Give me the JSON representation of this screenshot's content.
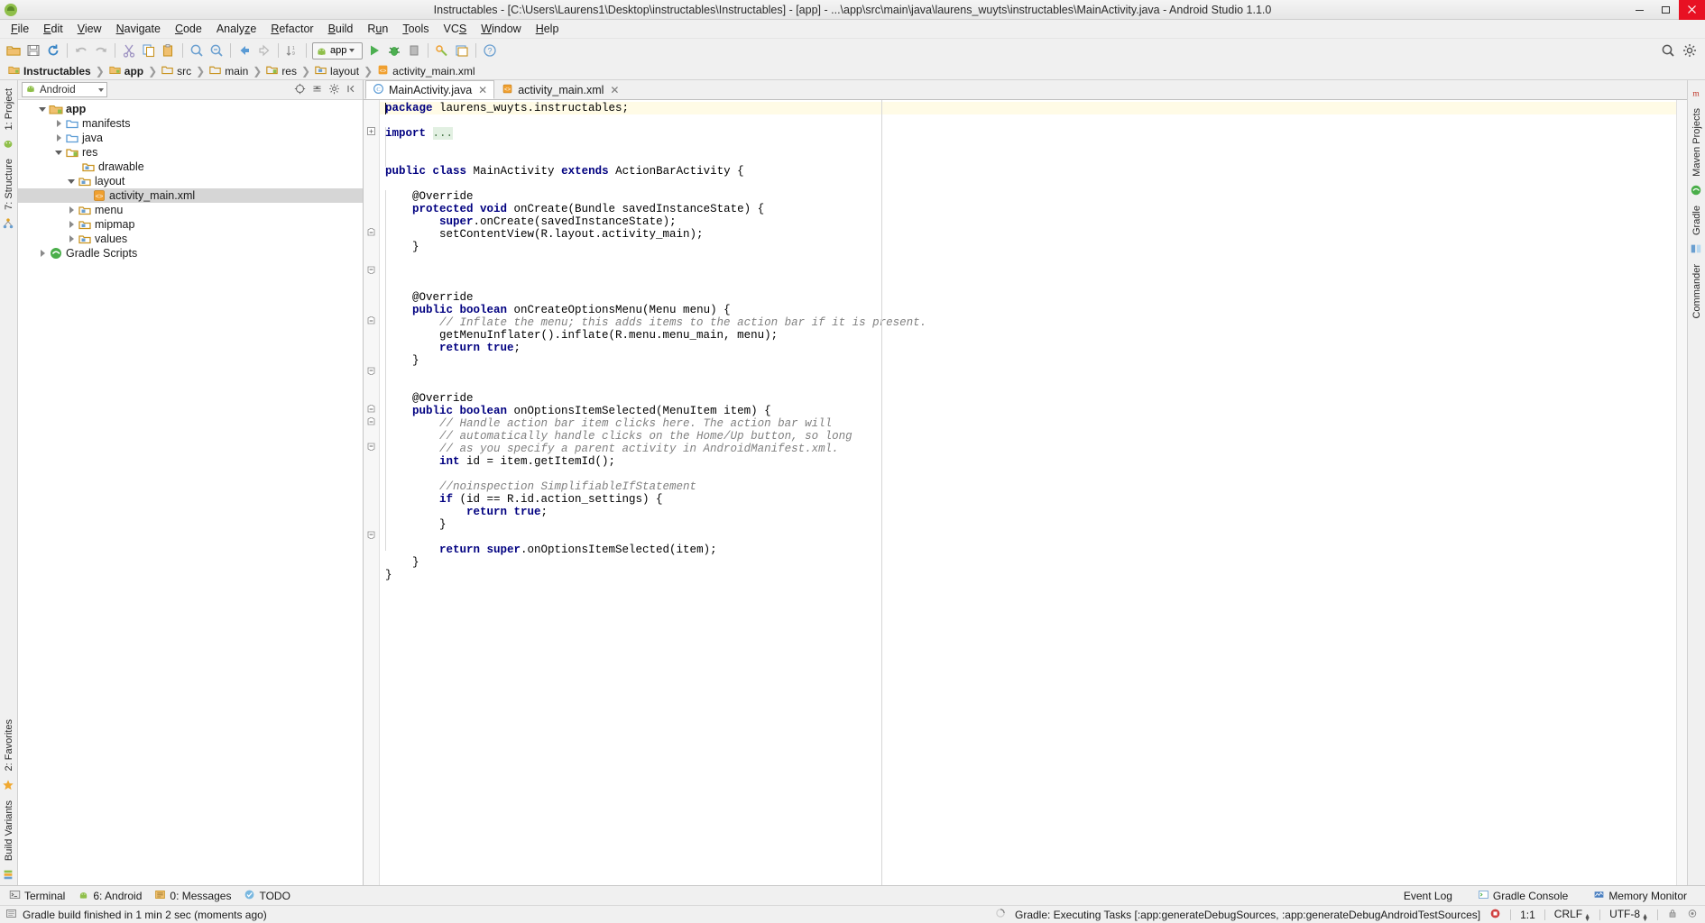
{
  "window": {
    "title": "Instructables - [C:\\Users\\Laurens1\\Desktop\\instructables\\Instructables] - [app] - ...\\app\\src\\main\\java\\laurens_wuyts\\instructables\\MainActivity.java - Android Studio 1.1.0",
    "minimize_label": "—",
    "maximize_label": "▢",
    "close_label": "✕"
  },
  "menubar": {
    "items": [
      {
        "label": "File"
      },
      {
        "label": "Edit"
      },
      {
        "label": "View"
      },
      {
        "label": "Navigate"
      },
      {
        "label": "Code"
      },
      {
        "label": "Analyze"
      },
      {
        "label": "Refactor"
      },
      {
        "label": "Build"
      },
      {
        "label": "Run"
      },
      {
        "label": "Tools"
      },
      {
        "label": "VCS"
      },
      {
        "label": "Window"
      },
      {
        "label": "Help"
      }
    ]
  },
  "toolbar": {
    "run_config": "app",
    "icons": [
      "open-folder-icon",
      "save-all-icon",
      "sync-icon",
      "undo-icon",
      "redo-icon",
      "cut-icon",
      "copy-icon",
      "paste-icon",
      "find-icon",
      "replace-icon",
      "back-icon",
      "forward-icon",
      "sort-icon"
    ],
    "right_icons": [
      "search-everywhere-icon",
      "settings-icon"
    ]
  },
  "breadcrumbs": {
    "items": [
      {
        "label": "Instructables",
        "icon": "module-icon",
        "bold": true
      },
      {
        "label": "app",
        "icon": "module-icon",
        "bold": true
      },
      {
        "label": "src",
        "icon": "folder-icon",
        "bold": false
      },
      {
        "label": "main",
        "icon": "folder-icon",
        "bold": false
      },
      {
        "label": "res",
        "icon": "res-folder-icon",
        "bold": false
      },
      {
        "label": "layout",
        "icon": "res-folder-icon",
        "bold": false
      },
      {
        "label": "activity_main.xml",
        "icon": "xml-file-icon",
        "bold": false
      }
    ],
    "separator": "❯"
  },
  "left_rail": {
    "items": [
      {
        "label": "1: Project",
        "icon": "project-icon"
      },
      {
        "label": "7: Structure",
        "icon": "structure-icon"
      },
      {
        "label": "2: Favorites",
        "icon": "favorites-star-icon"
      },
      {
        "label": "Build Variants",
        "icon": "build-variants-icon"
      }
    ]
  },
  "right_rail": {
    "items": [
      {
        "label": "Maven Projects",
        "icon": "maven-icon"
      },
      {
        "label": "Gradle",
        "icon": "gradle-icon"
      },
      {
        "label": "Commander",
        "icon": "commander-icon"
      }
    ]
  },
  "project_panel": {
    "view_selector": "Android",
    "view_icon": "android-icon",
    "header_icons": [
      "target-icon",
      "collapse-all-icon",
      "settings-gear-icon",
      "hide-icon"
    ],
    "tree": [
      {
        "label": "app",
        "depth": 0,
        "twisty": "down",
        "icon": "module-icon",
        "bold": true,
        "selected": false
      },
      {
        "label": "manifests",
        "depth": 1,
        "twisty": "right",
        "icon": "folder-blue-icon",
        "bold": false,
        "selected": false
      },
      {
        "label": "java",
        "depth": 1,
        "twisty": "right",
        "icon": "folder-blue-icon",
        "bold": false,
        "selected": false
      },
      {
        "label": "res",
        "depth": 1,
        "twisty": "down",
        "icon": "res-folder-icon",
        "bold": false,
        "selected": false
      },
      {
        "label": "drawable",
        "depth": 2,
        "twisty": "none",
        "icon": "res-folder-icon",
        "bold": false,
        "selected": false
      },
      {
        "label": "layout",
        "depth": 2,
        "twisty": "down",
        "icon": "res-folder-icon",
        "bold": false,
        "selected": false
      },
      {
        "label": "activity_main.xml",
        "depth": 3,
        "twisty": "none",
        "icon": "xml-file-icon",
        "bold": false,
        "selected": true
      },
      {
        "label": "menu",
        "depth": 2,
        "twisty": "right",
        "icon": "res-folder-icon",
        "bold": false,
        "selected": false
      },
      {
        "label": "mipmap",
        "depth": 2,
        "twisty": "right",
        "icon": "res-folder-icon",
        "bold": false,
        "selected": false
      },
      {
        "label": "values",
        "depth": 2,
        "twisty": "right",
        "icon": "res-folder-icon",
        "bold": false,
        "selected": false
      },
      {
        "label": "Gradle Scripts",
        "depth": 0,
        "twisty": "right",
        "icon": "gradle-icon",
        "bold": false,
        "selected": false
      }
    ]
  },
  "editor": {
    "tabs": [
      {
        "label": "MainActivity.java",
        "icon": "java-class-icon",
        "active": true,
        "close": "✕"
      },
      {
        "label": "activity_main.xml",
        "icon": "xml-file-icon",
        "active": false,
        "close": "✕"
      }
    ],
    "code_lines": [
      [
        {
          "t": "package ",
          "c": "kw"
        },
        {
          "t": "laurens_wuyts.instructables;",
          "c": "pl"
        }
      ],
      [],
      [
        {
          "t": "import ",
          "c": "kw"
        },
        {
          "t": "...",
          "c": "fold-ph"
        }
      ],
      [],
      [],
      [
        {
          "t": "public class ",
          "c": "kw"
        },
        {
          "t": "MainActivity ",
          "c": "pl"
        },
        {
          "t": "extends ",
          "c": "kw"
        },
        {
          "t": "ActionBarActivity {",
          "c": "pl"
        }
      ],
      [],
      [
        {
          "t": "    @Override",
          "c": "pl"
        }
      ],
      [
        {
          "t": "    protected void ",
          "c": "kw"
        },
        {
          "t": "onCreate(Bundle savedInstanceState) {",
          "c": "pl"
        }
      ],
      [
        {
          "t": "        super",
          "c": "kw"
        },
        {
          "t": ".onCreate(savedInstanceState);",
          "c": "pl"
        }
      ],
      [
        {
          "t": "        setContentView(R.layout.activity_main);",
          "c": "pl"
        }
      ],
      [
        {
          "t": "    }",
          "c": "pl"
        }
      ],
      [],
      [],
      [],
      [
        {
          "t": "    @Override",
          "c": "pl"
        }
      ],
      [
        {
          "t": "    public boolean ",
          "c": "kw"
        },
        {
          "t": "onCreateOptionsMenu(Menu menu) {",
          "c": "pl"
        }
      ],
      [
        {
          "t": "        // Inflate the menu; this adds items to the action bar if it is present.",
          "c": "cm"
        }
      ],
      [
        {
          "t": "        getMenuInflater().inflate(R.menu.menu_main, menu);",
          "c": "pl"
        }
      ],
      [
        {
          "t": "        return true",
          "c": "kw"
        },
        {
          "t": ";",
          "c": "pl"
        }
      ],
      [
        {
          "t": "    }",
          "c": "pl"
        }
      ],
      [],
      [],
      [
        {
          "t": "    @Override",
          "c": "pl"
        }
      ],
      [
        {
          "t": "    public boolean ",
          "c": "kw"
        },
        {
          "t": "onOptionsItemSelected(MenuItem item) {",
          "c": "pl"
        }
      ],
      [
        {
          "t": "        // Handle action bar item clicks here. The action bar will",
          "c": "cm"
        }
      ],
      [
        {
          "t": "        // automatically handle clicks on the Home/Up button, so long",
          "c": "cm"
        }
      ],
      [
        {
          "t": "        // as you specify a parent activity in AndroidManifest.xml.",
          "c": "cm"
        }
      ],
      [
        {
          "t": "        int ",
          "c": "kw"
        },
        {
          "t": "id = item.getItemId();",
          "c": "pl"
        }
      ],
      [],
      [
        {
          "t": "        //noinspection SimplifiableIfStatement",
          "c": "cm"
        }
      ],
      [
        {
          "t": "        if ",
          "c": "kw"
        },
        {
          "t": "(id == R.id.action_settings) {",
          "c": "pl"
        }
      ],
      [
        {
          "t": "            return true",
          "c": "kw"
        },
        {
          "t": ";",
          "c": "pl"
        }
      ],
      [
        {
          "t": "        }",
          "c": "pl"
        }
      ],
      [],
      [
        {
          "t": "        return super",
          "c": "kw"
        },
        {
          "t": ".onOptionsItemSelected(item);",
          "c": "pl"
        }
      ],
      [
        {
          "t": "    }",
          "c": "pl"
        }
      ],
      [
        {
          "t": "}",
          "c": "pl"
        }
      ]
    ]
  },
  "bottom_bar": {
    "items": [
      {
        "label": "Terminal",
        "icon": "terminal-icon"
      },
      {
        "label": "6: Android",
        "icon": "android-icon"
      },
      {
        "label": "0: Messages",
        "icon": "messages-icon"
      },
      {
        "label": "TODO",
        "icon": "todo-icon"
      }
    ],
    "right_items": [
      {
        "label": "Event Log",
        "icon": "event-log-icon"
      },
      {
        "label": "Gradle Console",
        "icon": "gradle-console-icon"
      },
      {
        "label": "Memory Monitor",
        "icon": "memory-monitor-icon"
      }
    ]
  },
  "status_bar": {
    "message": "Gradle build finished in 1 min 2 sec (moments ago)",
    "message_icon": "info-icon",
    "background_task": "Gradle: Executing Tasks [:app:generateDebugSources, :app:generateDebugAndroidTestSources]",
    "background_icon": "spinner-icon",
    "stop_icon": "stop-icon",
    "caret_position": "1:1",
    "line_separator": "CRLF",
    "encoding": "UTF-8",
    "lock_icon": "lock-icon",
    "hector_icon": "hector-icon"
  },
  "colors": {
    "chrome": "#f0f0f0",
    "editor_bg": "#ffffff",
    "keyword": "#000080",
    "comment": "#808080",
    "selection": "#d6d6d6",
    "caret_line": "#fffbe6",
    "android_green": "#8fbf4a",
    "close_red": "#e81123"
  }
}
